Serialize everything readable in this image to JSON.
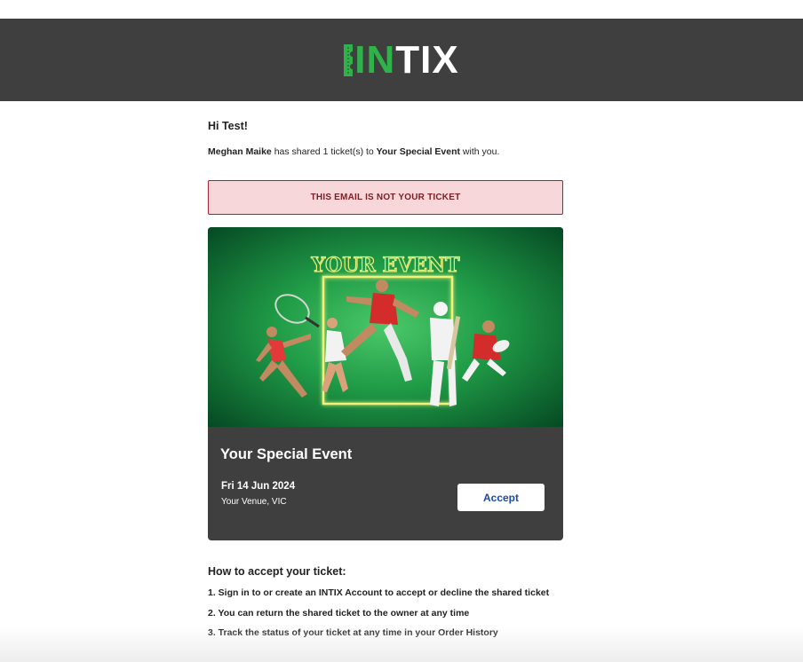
{
  "brand": {
    "logo_accent": "IN",
    "logo_rest": "TIX",
    "accent_color": "#2fb24a",
    "header_bg": "#3f3f3f"
  },
  "email": {
    "greeting": "Hi Test!",
    "sharer_name": "Meghan Maike",
    "share_text_middle": " has shared 1 ticket(s) to ",
    "event_name_inline": "Your Special Event",
    "share_text_end": " with you.",
    "warning": "THIS EMAIL IS NOT YOUR TICKET"
  },
  "event": {
    "image_banner_text": "YOUR EVENT",
    "title": "Your Special Event",
    "date": "Fri 14 Jun 2024",
    "venue": "Your Venue, VIC",
    "accept_label": "Accept"
  },
  "instructions": {
    "title": "How to accept your ticket:",
    "steps": [
      "1. Sign in to or create an INTIX Account to accept or decline the shared ticket",
      "2. You can return the shared ticket to the owner at any time",
      "3. Track the status of your ticket at any time in your Order History"
    ]
  }
}
